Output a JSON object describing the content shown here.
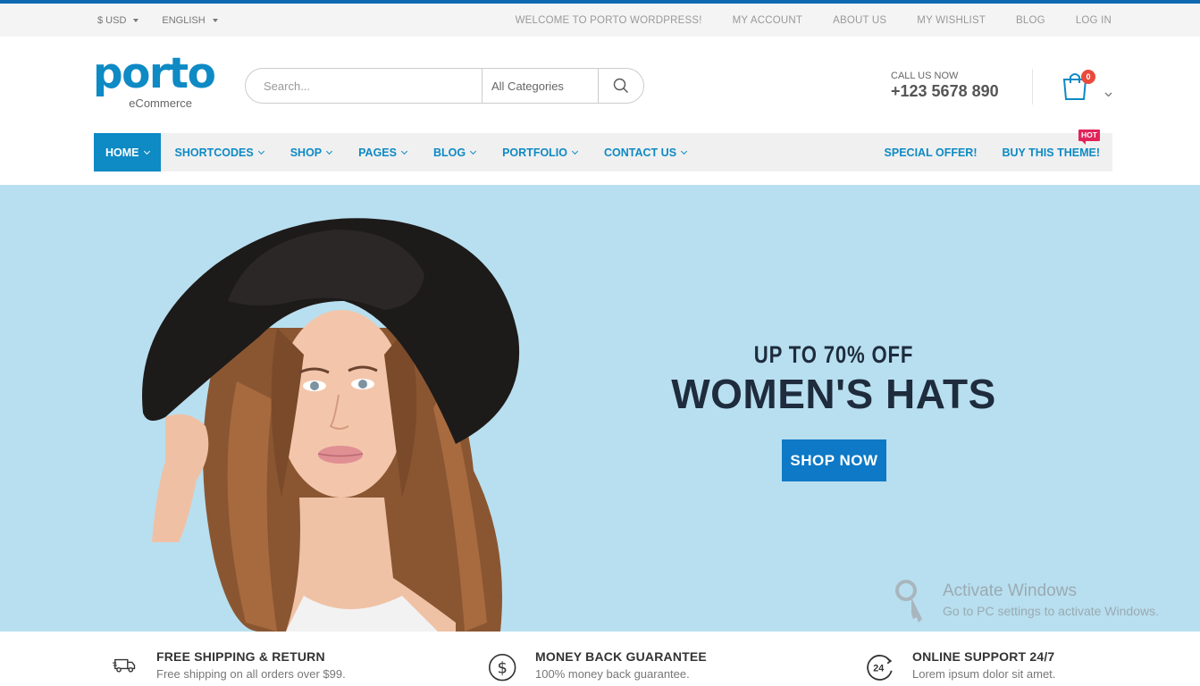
{
  "colors": {
    "accent": "#0e8ac4",
    "hero_bg": "#b8dfef",
    "hot_badge": "#e2235a",
    "cart_badge": "#ea4a3b",
    "topbar_bg": "#f4f4f4"
  },
  "topbar": {
    "currency": "$ USD",
    "language": "ENGLISH",
    "links": [
      "WELCOME TO PORTO WORDPRESS!",
      "MY ACCOUNT",
      "ABOUT US",
      "MY WISHLIST",
      "BLOG",
      "LOG IN"
    ]
  },
  "header": {
    "logo_word": "porto",
    "logo_sub": "eCommerce",
    "search_placeholder": "Search...",
    "category": "All Categories",
    "call_label": "CALL US NOW",
    "phone": "+123 5678 890",
    "cart_count": "0"
  },
  "nav": {
    "items": [
      "HOME",
      "SHORTCODES",
      "SHOP",
      "PAGES",
      "BLOG",
      "PORTFOLIO",
      "CONTACT US"
    ],
    "special_offer": "SPECIAL OFFER!",
    "buy_theme": "BUY THIS THEME!",
    "hot": "HOT"
  },
  "hero": {
    "subtitle": "UP TO 70% OFF",
    "title": "WOMEN'S HATS",
    "cta": "SHOP NOW"
  },
  "watermark": {
    "line1": "Activate Windows",
    "line2": "Go to PC settings to activate Windows."
  },
  "features": [
    {
      "icon": "truck-icon",
      "title": "FREE SHIPPING & RETURN",
      "desc": "Free shipping on all orders over $99."
    },
    {
      "icon": "dollar-icon",
      "title": "MONEY BACK GUARANTEE",
      "desc": "100% money back guarantee."
    },
    {
      "icon": "support-24-icon",
      "title": "ONLINE SUPPORT 24/7",
      "desc": "Lorem ipsum dolor sit amet."
    }
  ]
}
